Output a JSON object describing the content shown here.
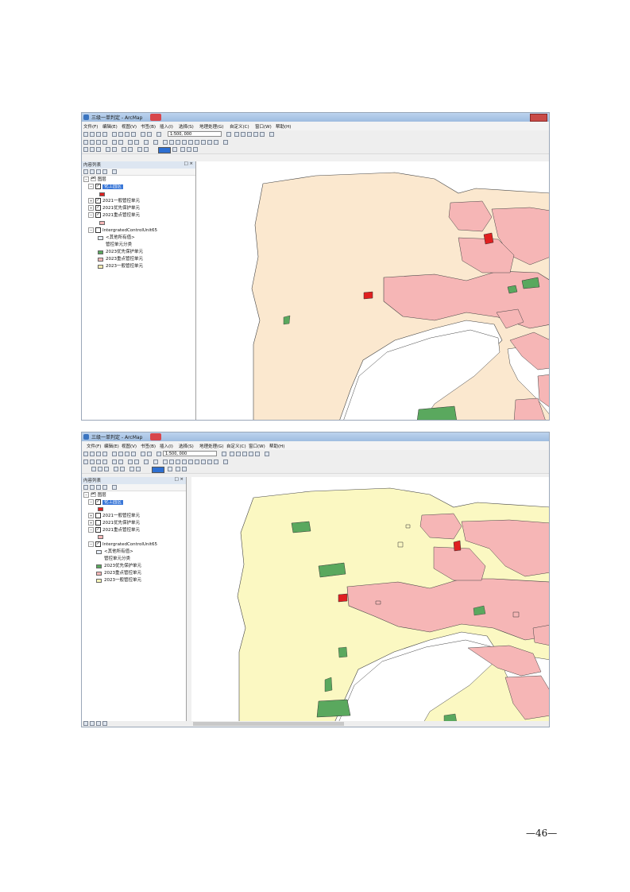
{
  "window": {
    "title": "三级一单判定 - ArcMap",
    "menus": [
      "文件(F)",
      "编辑(E)",
      "视图(V)",
      "书签(B)",
      "插入(I)",
      "选择(S)",
      "地理处理(G)",
      "自定义(C)",
      "窗口(W)",
      "帮助(H)"
    ],
    "scale": "1:500, 000"
  },
  "toc": {
    "header": "内容列表",
    "root": "图层",
    "items": [
      {
        "label": "化工园区",
        "checked": true,
        "swatch": "#e02020"
      },
      {
        "label": "2021一般管控单元",
        "checked": true
      },
      {
        "label": "2021优先保护单元",
        "checked": true
      },
      {
        "label": "2021重点管控单元",
        "checked": true,
        "swatch": "#f6b6b6"
      },
      {
        "label": "IntergratedControlUnit65",
        "checked": false
      },
      {
        "label": "<其他所有值>",
        "swatch": "#e8f0ff"
      },
      {
        "label": "管控单元分类"
      },
      {
        "label": "2023优先保护单元",
        "swatch": "#5aa85e"
      },
      {
        "label": "2023重点管控单元",
        "swatch": "#f6b6b6"
      },
      {
        "label": "2023一般管控单元",
        "swatch": "#f8ecb0"
      }
    ]
  },
  "toc2": {
    "header": "内容列表",
    "root": "图层",
    "items": [
      {
        "label": "化工园区",
        "checked": true,
        "swatch": "#e02020"
      },
      {
        "label": "2021一般管控单元",
        "checked": false
      },
      {
        "label": "2021优先保护单元",
        "checked": false
      },
      {
        "label": "2021重点管控单元",
        "checked": true,
        "swatch": "#f6b6b6"
      },
      {
        "label": "IntergratedControlUnit65",
        "checked": true
      },
      {
        "label": "<其他所有值>",
        "swatch": "#e8f0ff"
      },
      {
        "label": "管控单元分类"
      },
      {
        "label": "2023优先保护单元",
        "swatch": "#5aa85e"
      },
      {
        "label": "2023重点管控单元",
        "swatch": "#f6b6b6"
      },
      {
        "label": "2023一般管控单元",
        "swatch": "#f8f6b8"
      }
    ]
  },
  "colors": {
    "general_2021": "#fbe8cf",
    "general_2023": "#fbf8c2",
    "key": "#f6b6b6",
    "priority": "#5aa85e",
    "chem": "#e02020"
  },
  "page_number": "—46—"
}
